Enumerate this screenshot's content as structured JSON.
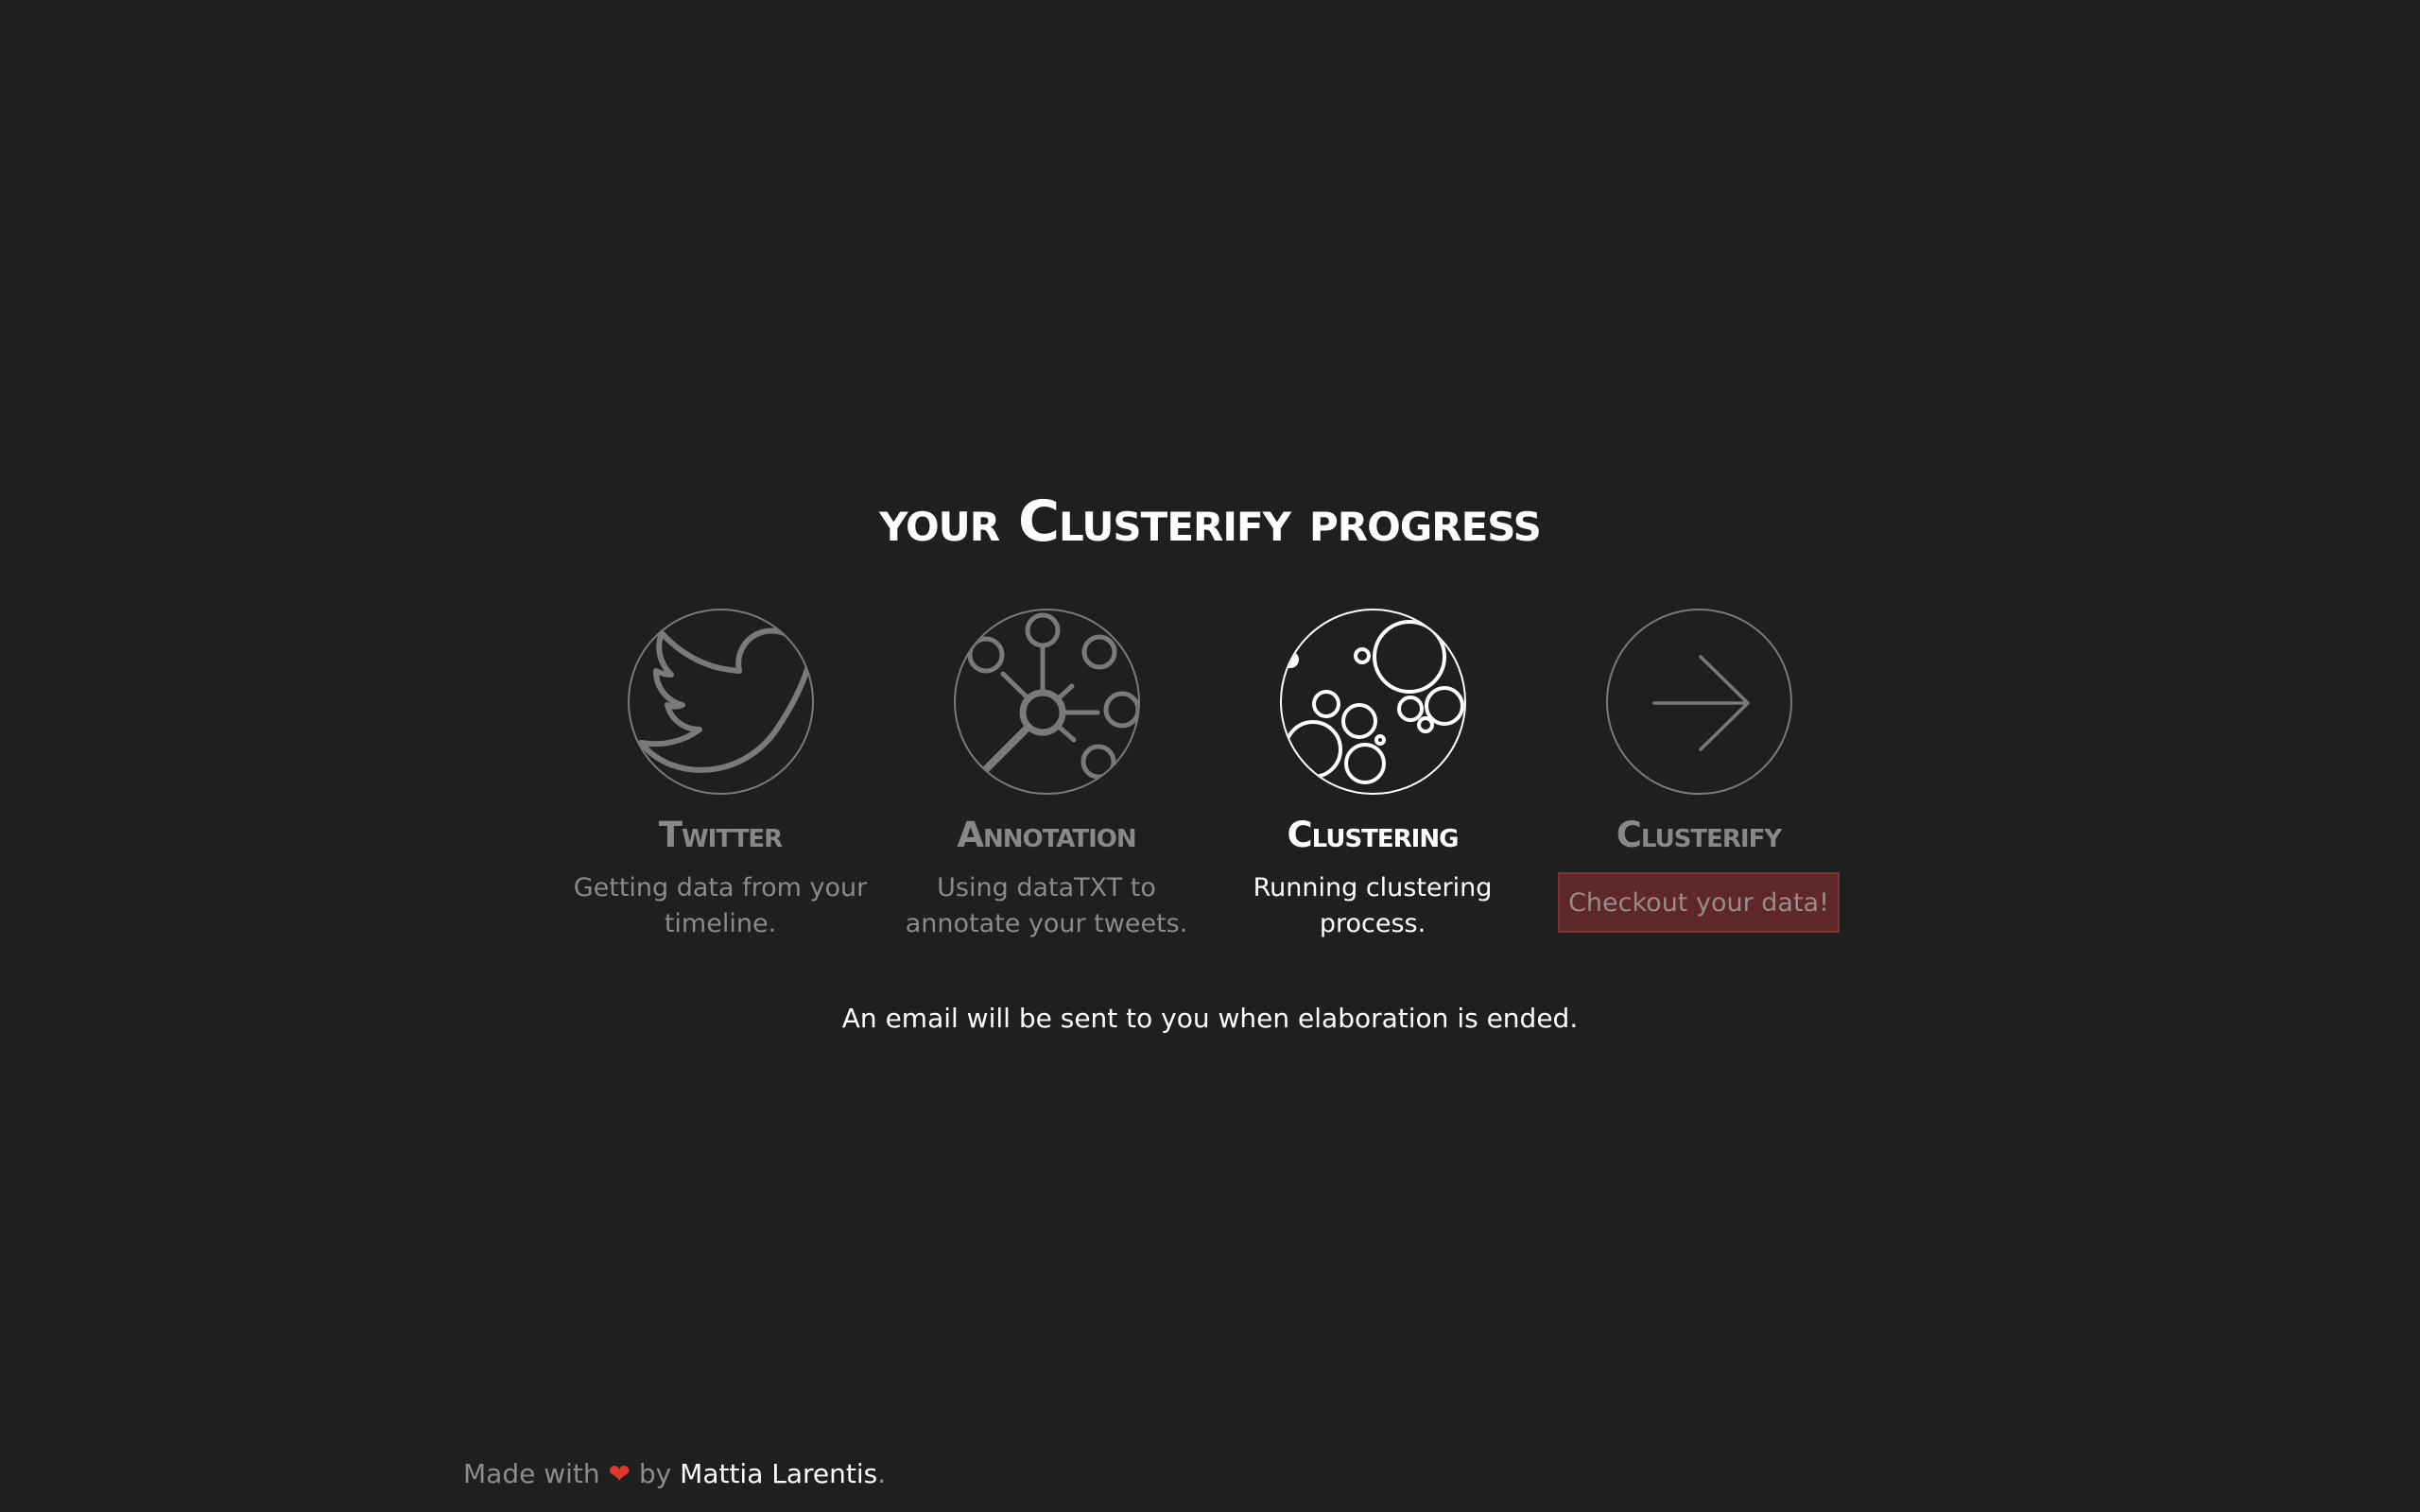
{
  "title": "your Clusterify progress",
  "steps": [
    {
      "name": "Twitter",
      "description": "Getting data from your timeline.",
      "icon": "twitter-bird-icon",
      "state": "done"
    },
    {
      "name": "Annotation",
      "description": "Using dataTXT to annotate your tweets.",
      "icon": "network-nodes-icon",
      "state": "done"
    },
    {
      "name": "Clustering",
      "description": "Running clustering process.",
      "icon": "bubbles-cluster-icon",
      "state": "active"
    },
    {
      "name": "Clusterify",
      "button_label": "Checkout your data!",
      "icon": "arrow-right-icon",
      "state": "pending"
    }
  ],
  "notice": "An email will be sent to you when elaboration is ended.",
  "footer": {
    "prefix": "Made with",
    "heart": "❤",
    "by": "by",
    "author": "Mattia Larentis",
    "suffix": "."
  },
  "colors": {
    "background": "#1f1f1f",
    "active": "#ffffff",
    "inactive": "#888888",
    "button_bg": "#5e2828",
    "heart": "#e0392b"
  }
}
